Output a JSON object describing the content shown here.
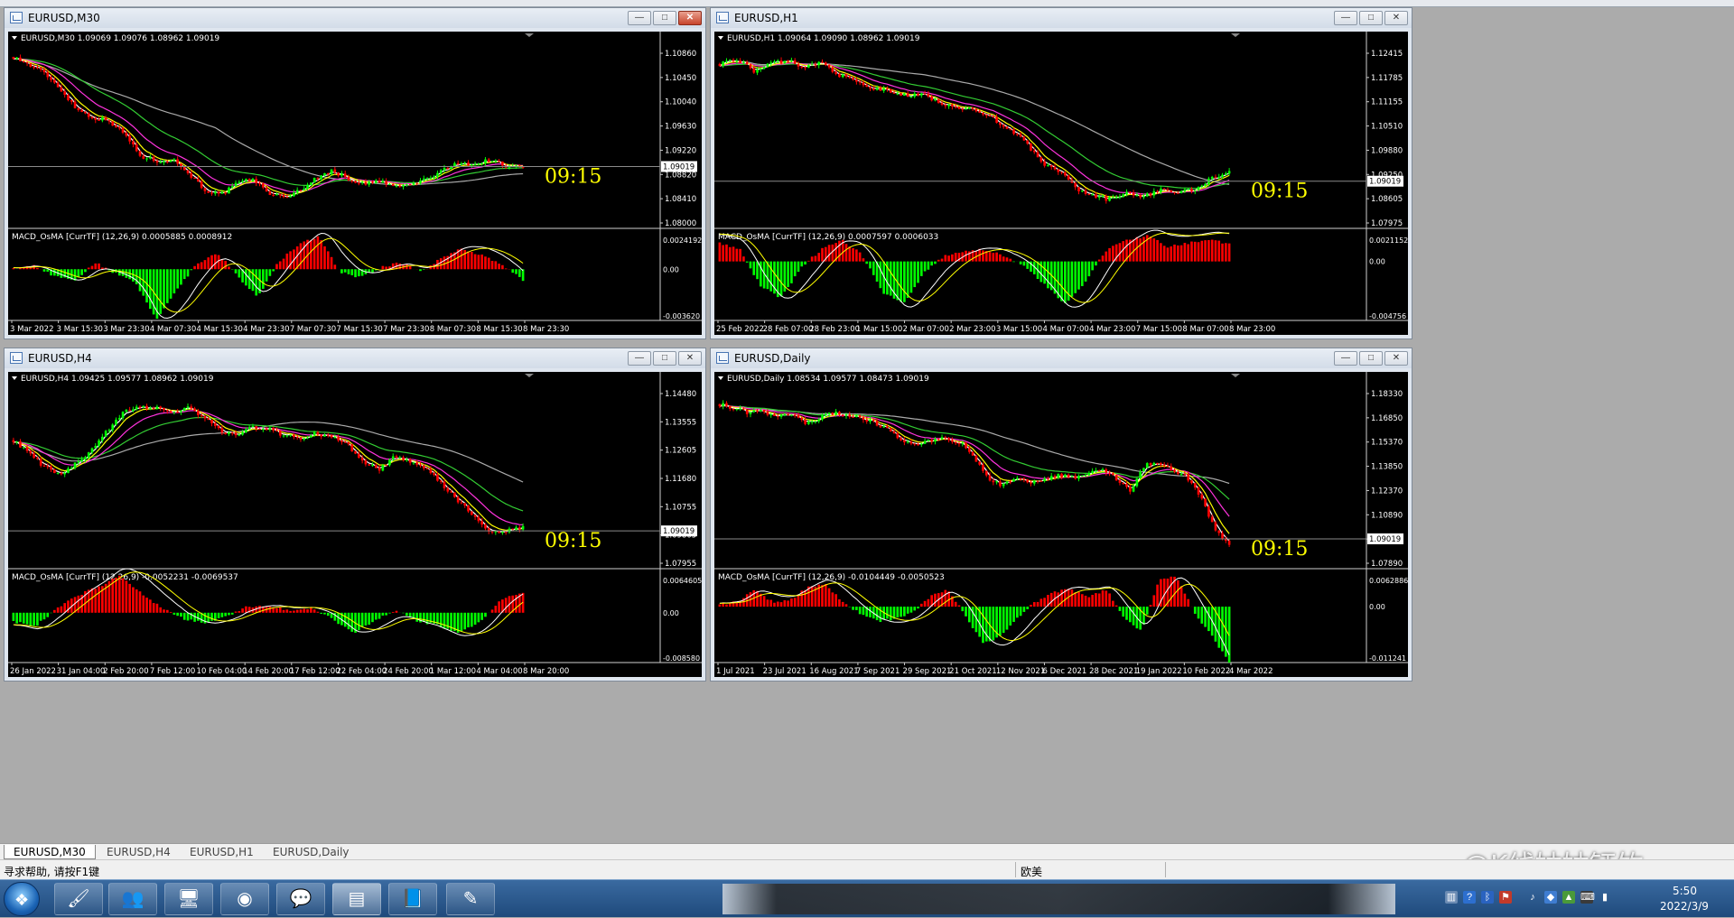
{
  "app": {
    "status_help": "寻求帮助, 请按F1键",
    "status_profile": "欧美"
  },
  "tabs": [
    "EURUSD,M30",
    "EURUSD,H4",
    "EURUSD,H1",
    "EURUSD,Daily"
  ],
  "watermark": "@K线姑姑钰竹",
  "taskbar": {
    "time": "5:50",
    "date": "2022/3/9"
  },
  "colors": {
    "bull": "#00ff00",
    "bear": "#ff0000",
    "ma_white": "#ffffff",
    "ma_yellow": "#ffff00",
    "ma_magenta": "#ff33dd",
    "ma_green": "#33cc33",
    "ma_gray": "#aaaaaa",
    "clock": "#ffff00",
    "grid_line": "#8a8a8a"
  },
  "charts": [
    {
      "window_title": "EURUSD,M30",
      "header": "EURUSD,M30  1.09069 1.09076 1.08962 1.09019",
      "clock": "09:15",
      "price_ticks": [
        "1.10860",
        "1.10450",
        "1.10040",
        "1.09630",
        "1.09220",
        "1.08820",
        "1.08410",
        "1.08000"
      ],
      "current_price": "1.09019",
      "macd_label": "MACD_OsMA [CurrTF] (12,26,9) 0.0005885 0.0008912",
      "macd_ticks": [
        "0.0024192",
        "0.00",
        "-0.003620"
      ],
      "time_labels": [
        "3 Mar 2022",
        "3 Mar 15:30",
        "3 Mar 23:30",
        "4 Mar 07:30",
        "4 Mar 15:30",
        "4 Mar 23:30",
        "7 Mar 07:30",
        "7 Mar 15:30",
        "7 Mar 23:30",
        "8 Mar 07:30",
        "8 Mar 15:30",
        "8 Mar 23:30"
      ],
      "chart_data": {
        "type": "line",
        "ylim": [
          1.08,
          1.1113
        ],
        "current_price": 1.09019,
        "price_path": [
          1.11,
          1.1085,
          1.107,
          1.104,
          1.1005,
          1.099,
          1.0985,
          1.096,
          1.092,
          1.0912,
          1.0915,
          1.089,
          1.086,
          1.085,
          1.087,
          1.088,
          1.0855,
          1.0845,
          1.086,
          1.088,
          1.0895,
          1.088,
          1.087,
          1.0875,
          1.0865,
          1.087,
          1.088,
          1.0895,
          1.091,
          1.0905,
          1.0915,
          1.09,
          1.0902
        ],
        "macd_range": [
          -0.00362,
          0.0024192
        ],
        "macd_hist_path": [
          0.0,
          0.0003,
          -0.0005,
          -0.0008,
          0.0005,
          -0.0003,
          -0.001,
          -0.0036,
          -0.0015,
          0.0004,
          0.0012,
          -0.0005,
          -0.002,
          0.0005,
          0.0018,
          0.0024,
          -0.0002,
          -0.0006,
          0.0001,
          0.0005,
          -0.0002,
          0.0008,
          0.0015,
          0.001,
          0.0003,
          -0.0008
        ]
      }
    },
    {
      "window_title": "EURUSD,H1",
      "header": "EURUSD,H1  1.09064 1.09090 1.08962 1.09019",
      "clock": "09:15",
      "price_ticks": [
        "1.12415",
        "1.11785",
        "1.11155",
        "1.10510",
        "1.09880",
        "1.09250",
        "1.08605",
        "1.07975"
      ],
      "current_price": "1.09019",
      "macd_label": "MACD_OsMA [CurrTF] (12,26,9) 0.0007597 0.0006033",
      "macd_ticks": [
        "0.0021152",
        "0.00",
        "-0.004756"
      ],
      "time_labels": [
        "25 Feb 2022",
        "28 Feb 07:00",
        "28 Feb 23:00",
        "1 Mar 15:00",
        "2 Mar 07:00",
        "2 Mar 23:00",
        "3 Mar 15:00",
        "4 Mar 07:00",
        "4 Mar 23:00",
        "7 Mar 15:00",
        "8 Mar 07:00",
        "8 Mar 23:00"
      ],
      "chart_data": {
        "type": "line",
        "ylim": [
          1.0785,
          1.127
        ],
        "current_price": 1.09019,
        "price_path": [
          1.123,
          1.1245,
          1.121,
          1.123,
          1.124,
          1.122,
          1.1235,
          1.12,
          1.118,
          1.116,
          1.1155,
          1.114,
          1.1145,
          1.112,
          1.111,
          1.11,
          1.108,
          1.105,
          1.101,
          1.095,
          1.093,
          1.088,
          1.086,
          1.085,
          1.087,
          1.086,
          1.088,
          1.087,
          1.088,
          1.091,
          1.093
        ],
        "macd_range": [
          -0.004756,
          0.0021152
        ],
        "macd_hist_path": [
          0.0015,
          0.001,
          -0.002,
          -0.003,
          -0.0005,
          0.001,
          0.0018,
          0.0005,
          -0.0025,
          -0.0035,
          -0.001,
          0.0004,
          0.0008,
          0.001,
          0.0004,
          -0.0004,
          -0.002,
          -0.0035,
          -0.0015,
          0.001,
          0.0018,
          0.0021,
          0.0012,
          0.0015,
          0.0018,
          0.0014
        ]
      }
    },
    {
      "window_title": "EURUSD,H4",
      "header": "EURUSD,H4  1.09425 1.09577 1.08962 1.09019",
      "clock": "09:15",
      "price_ticks": [
        "1.14480",
        "1.13555",
        "1.12605",
        "1.11680",
        "1.10755",
        "1.09805",
        "1.07955"
      ],
      "current_price": "1.09019",
      "macd_label": "MACD_OsMA [CurrTF] (12,26,9) -0.0052231 -0.0069537",
      "macd_ticks": [
        "0.0064605",
        "0.00",
        "-0.008580"
      ],
      "time_labels": [
        "26 Jan 2022",
        "31 Jan 04:00",
        "2 Feb 20:00",
        "7 Feb 12:00",
        "10 Feb 04:00",
        "14 Feb 20:00",
        "17 Feb 12:00",
        "22 Feb 04:00",
        "24 Feb 20:00",
        "1 Mar 12:00",
        "4 Mar 04:00",
        "8 Mar 20:00"
      ],
      "chart_data": {
        "type": "line",
        "ylim": [
          1.076,
          1.152
        ],
        "current_price": 1.09019,
        "price_path": [
          1.13,
          1.124,
          1.118,
          1.115,
          1.12,
          1.126,
          1.135,
          1.143,
          1.145,
          1.144,
          1.142,
          1.144,
          1.14,
          1.134,
          1.132,
          1.136,
          1.135,
          1.132,
          1.131,
          1.133,
          1.131,
          1.128,
          1.12,
          1.117,
          1.123,
          1.12,
          1.117,
          1.11,
          1.103,
          1.096,
          1.089,
          1.09,
          1.092
        ],
        "macd_range": [
          -0.00858,
          0.0064605
        ],
        "macd_hist_path": [
          -0.0015,
          -0.0025,
          0.0005,
          0.003,
          0.0045,
          0.0064,
          0.0035,
          0.0008,
          -0.001,
          -0.0018,
          -0.0008,
          0.001,
          0.0012,
          0.0004,
          0.0008,
          -0.001,
          -0.0035,
          -0.0015,
          0.0006,
          -0.0015,
          -0.0022,
          -0.0035,
          -0.0015,
          0.0025,
          0.0035
        ]
      }
    },
    {
      "window_title": "EURUSD,Daily",
      "header": "EURUSD,Daily  1.08534 1.09577 1.08473 1.09019",
      "clock": "09:15",
      "price_ticks": [
        "1.18330",
        "1.16850",
        "1.15370",
        "1.13850",
        "1.12370",
        "1.10890",
        "1.09370",
        "1.07890"
      ],
      "current_price": "1.09019",
      "macd_label": "MACD_OsMA [CurrTF] (12,26,9) -0.0104449 -0.0050523",
      "macd_ticks": [
        "0.0062886",
        "0.00",
        "-0.011241"
      ],
      "time_labels": [
        "1 Jul 2021",
        "23 Jul 2021",
        "16 Aug 2021",
        "7 Sep 2021",
        "29 Sep 2021",
        "21 Oct 2021",
        "12 Nov 2021",
        "6 Dec 2021",
        "28 Dec 2021",
        "19 Jan 2022",
        "10 Feb 2022",
        "4 Mar 2022"
      ],
      "chart_data": {
        "type": "line",
        "ylim": [
          1.073,
          1.195
        ],
        "current_price": 1.09019,
        "price_path": [
          1.185,
          1.182,
          1.179,
          1.18,
          1.176,
          1.178,
          1.172,
          1.175,
          1.179,
          1.177,
          1.175,
          1.172,
          1.166,
          1.159,
          1.156,
          1.16,
          1.161,
          1.158,
          1.147,
          1.132,
          1.128,
          1.132,
          1.13,
          1.132,
          1.135,
          1.133,
          1.136,
          1.14,
          1.132,
          1.124,
          1.142,
          1.144,
          1.138,
          1.134,
          1.12,
          1.096,
          1.085
        ],
        "macd_range": [
          -0.011241,
          0.0062886
        ],
        "macd_hist_path": [
          0.0005,
          0.001,
          0.0035,
          0.001,
          0.0012,
          0.004,
          0.0045,
          0.001,
          -0.0015,
          -0.003,
          -0.0025,
          -0.001,
          0.002,
          0.0035,
          -0.002,
          -0.0075,
          -0.006,
          -0.002,
          0.001,
          0.003,
          0.0035,
          0.002,
          0.0035,
          -0.002,
          -0.005,
          0.0055,
          0.0062,
          -0.001,
          -0.006,
          -0.0112
        ]
      }
    }
  ]
}
